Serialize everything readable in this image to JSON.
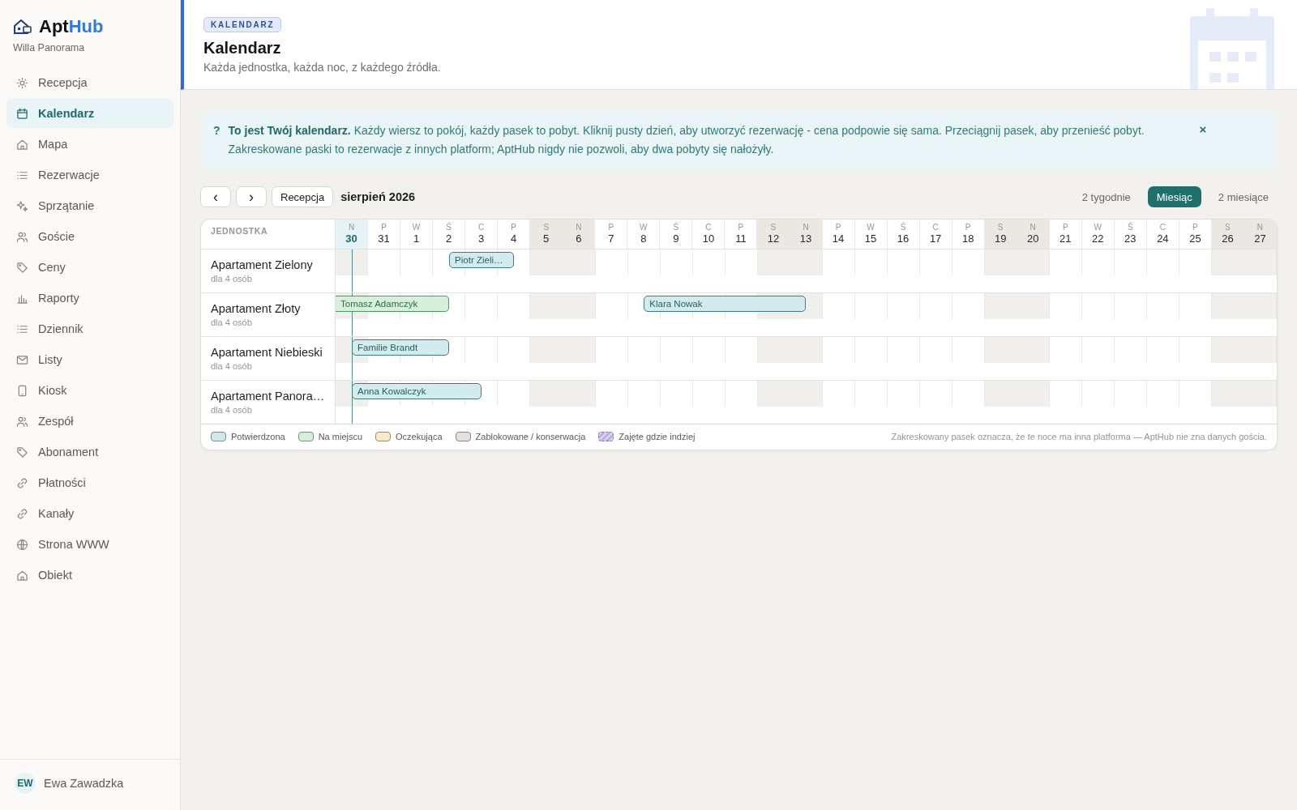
{
  "brand": {
    "name_start": "Apt",
    "name_end": "Hub",
    "property": "Willa Panorama"
  },
  "sidebar": {
    "items": [
      {
        "label": "Recepcja",
        "selected": false
      },
      {
        "label": "Kalendarz",
        "selected": true
      },
      {
        "label": "Mapa",
        "selected": false
      },
      {
        "label": "Rezerwacje",
        "selected": false
      },
      {
        "label": "Sprzątanie",
        "selected": false
      },
      {
        "label": "Goście",
        "selected": false
      },
      {
        "label": "Ceny",
        "selected": false
      },
      {
        "label": "Raporty",
        "selected": false
      },
      {
        "label": "Dziennik",
        "selected": false
      },
      {
        "label": "Listy",
        "selected": false
      },
      {
        "label": "Kiosk",
        "selected": false
      },
      {
        "label": "Zespół",
        "selected": false
      },
      {
        "label": "Abonament",
        "selected": false
      },
      {
        "label": "Płatności",
        "selected": false
      },
      {
        "label": "Kanały",
        "selected": false
      },
      {
        "label": "Strona WWW",
        "selected": false
      },
      {
        "label": "Obiekt",
        "selected": false
      }
    ],
    "user": {
      "initials": "EW",
      "name": "Ewa Zawadzka"
    }
  },
  "header": {
    "tag": "KALENDARZ",
    "title": "Kalendarz",
    "subtitle": "Każda jednostka, każda noc, z każdego źródła."
  },
  "notice": {
    "icon": "?",
    "text": "**To jest Twój kalendarz.** Każdy wiersz to pokój, każdy pasek to pobyt. Kliknij pusty dzień, aby utworzyć rezerwację - cena podpowie się sama. Przeciągnij pasek, aby przenieść pobyt. Zakreskowane paski to rezerwacje z innych platform; AptHub nigdy nie pozwoli, aby dwa pobyty się nałożyły.",
    "close": "×"
  },
  "toolbar": {
    "prev": "‹",
    "next": "›",
    "today": "Recepcja",
    "period": "sierpień 2026",
    "views": [
      {
        "label": "2 tygodnie",
        "selected": false
      },
      {
        "label": "Miesiąc",
        "selected": true
      },
      {
        "label": "2 miesiące",
        "selected": false
      }
    ]
  },
  "calendar": {
    "unit_header": "JEDNOSTKA",
    "days": [
      {
        "dow": "N",
        "day": "30",
        "kind": "today"
      },
      {
        "dow": "P",
        "day": "31",
        "kind": "weekday"
      },
      {
        "dow": "W",
        "day": "1",
        "kind": "weekday"
      },
      {
        "dow": "Ś",
        "day": "2",
        "kind": "weekday"
      },
      {
        "dow": "C",
        "day": "3",
        "kind": "weekday"
      },
      {
        "dow": "P",
        "day": "4",
        "kind": "weekday"
      },
      {
        "dow": "S",
        "day": "5",
        "kind": "weekend"
      },
      {
        "dow": "N",
        "day": "6",
        "kind": "weekend"
      },
      {
        "dow": "P",
        "day": "7",
        "kind": "weekday"
      },
      {
        "dow": "W",
        "day": "8",
        "kind": "weekday"
      },
      {
        "dow": "Ś",
        "day": "9",
        "kind": "weekday"
      },
      {
        "dow": "C",
        "day": "10",
        "kind": "weekday"
      },
      {
        "dow": "P",
        "day": "11",
        "kind": "weekday"
      },
      {
        "dow": "S",
        "day": "12",
        "kind": "weekend"
      },
      {
        "dow": "N",
        "day": "13",
        "kind": "weekend"
      },
      {
        "dow": "P",
        "day": "14",
        "kind": "weekday"
      },
      {
        "dow": "W",
        "day": "15",
        "kind": "weekday"
      },
      {
        "dow": "Ś",
        "day": "16",
        "kind": "weekday"
      },
      {
        "dow": "C",
        "day": "17",
        "kind": "weekday"
      },
      {
        "dow": "P",
        "day": "18",
        "kind": "weekday"
      },
      {
        "dow": "S",
        "day": "19",
        "kind": "weekend"
      },
      {
        "dow": "N",
        "day": "20",
        "kind": "weekend"
      },
      {
        "dow": "P",
        "day": "21",
        "kind": "weekday"
      },
      {
        "dow": "W",
        "day": "22",
        "kind": "weekday"
      },
      {
        "dow": "Ś",
        "day": "23",
        "kind": "weekday"
      },
      {
        "dow": "C",
        "day": "24",
        "kind": "weekday"
      },
      {
        "dow": "P",
        "day": "25",
        "kind": "weekday"
      },
      {
        "dow": "S",
        "day": "26",
        "kind": "weekend"
      },
      {
        "dow": "N",
        "day": "27",
        "kind": "weekend"
      }
    ],
    "units": [
      {
        "name": "Apartament Zielony",
        "capacity": "dla 4 osób",
        "bookings": [
          {
            "guest": "Piotr Zieli…",
            "kind": "confirmed"
          }
        ],
        "nights": [
          {
            "kind": "free"
          },
          {
            "kind": "free"
          },
          {
            "kind": "free"
          },
          {
            "kind": "arrival"
          },
          {
            "kind": "stay"
          },
          {
            "kind": "departure"
          },
          {
            "kind": "free"
          },
          {
            "kind": "free"
          },
          {
            "kind": "free"
          },
          {
            "kind": "free"
          },
          {
            "kind": "free"
          },
          {
            "kind": "free"
          },
          {
            "kind": "free"
          },
          {
            "kind": "free"
          },
          {
            "kind": "free"
          },
          {
            "kind": "free"
          },
          {
            "kind": "free"
          },
          {
            "kind": "free"
          },
          {
            "kind": "free"
          },
          {
            "kind": "free"
          },
          {
            "kind": "free"
          },
          {
            "kind": "free"
          },
          {
            "kind": "free"
          },
          {
            "kind": "free"
          },
          {
            "kind": "free"
          },
          {
            "kind": "free"
          },
          {
            "kind": "free"
          },
          {
            "kind": "free"
          },
          {
            "kind": "free"
          }
        ]
      },
      {
        "name": "Apartament Złoty",
        "capacity": "dla 4 osób",
        "bookings": [
          {
            "guest": "Tomasz Adamczyk",
            "kind": "onsite"
          },
          {
            "guest": "Klara Nowak",
            "kind": "confirmed"
          }
        ],
        "nights": [
          {
            "kind": "stay"
          },
          {
            "kind": "stay"
          },
          {
            "kind": "stay"
          },
          {
            "kind": "departure"
          },
          {
            "kind": "free"
          },
          {
            "kind": "free"
          },
          {
            "kind": "free"
          },
          {
            "kind": "free"
          },
          {
            "kind": "free"
          },
          {
            "kind": "arrival"
          },
          {
            "kind": "stay"
          },
          {
            "kind": "stay"
          },
          {
            "kind": "stay"
          },
          {
            "kind": "stay"
          },
          {
            "kind": "departure"
          },
          {
            "kind": "free"
          },
          {
            "kind": "free"
          },
          {
            "kind": "free"
          },
          {
            "kind": "free"
          },
          {
            "kind": "free"
          },
          {
            "kind": "free"
          },
          {
            "kind": "free"
          },
          {
            "kind": "free"
          },
          {
            "kind": "free"
          },
          {
            "kind": "free"
          },
          {
            "kind": "free"
          },
          {
            "kind": "free"
          },
          {
            "kind": "free"
          },
          {
            "kind": "free"
          }
        ]
      },
      {
        "name": "Apartament Niebieski",
        "capacity": "dla 4 osób",
        "bookings": [
          {
            "guest": "Familie Brandt",
            "kind": "confirmed"
          }
        ],
        "nights": [
          {
            "kind": "arrival"
          },
          {
            "kind": "stay"
          },
          {
            "kind": "stay"
          },
          {
            "kind": "departure"
          },
          {
            "kind": "free"
          },
          {
            "kind": "free"
          },
          {
            "kind": "free"
          },
          {
            "kind": "free"
          },
          {
            "kind": "free"
          },
          {
            "kind": "free"
          },
          {
            "kind": "free"
          },
          {
            "kind": "free"
          },
          {
            "kind": "free"
          },
          {
            "kind": "free"
          },
          {
            "kind": "free"
          },
          {
            "kind": "free"
          },
          {
            "kind": "free"
          },
          {
            "kind": "free"
          },
          {
            "kind": "free"
          },
          {
            "kind": "free"
          },
          {
            "kind": "free"
          },
          {
            "kind": "free"
          },
          {
            "kind": "free"
          },
          {
            "kind": "free"
          },
          {
            "kind": "free"
          },
          {
            "kind": "free"
          },
          {
            "kind": "free"
          },
          {
            "kind": "free"
          },
          {
            "kind": "free"
          }
        ]
      },
      {
        "name": "Apartament Panora…",
        "capacity": "dla 4 osób",
        "bookings": [
          {
            "guest": "Anna Kowalczyk",
            "kind": "confirmed"
          }
        ],
        "nights": [
          {
            "kind": "arrival"
          },
          {
            "kind": "stay"
          },
          {
            "kind": "stay"
          },
          {
            "kind": "stay"
          },
          {
            "kind": "departure"
          },
          {
            "kind": "free"
          },
          {
            "kind": "free"
          },
          {
            "kind": "free"
          },
          {
            "kind": "free"
          },
          {
            "kind": "free"
          },
          {
            "kind": "free"
          },
          {
            "kind": "free"
          },
          {
            "kind": "free"
          },
          {
            "kind": "free"
          },
          {
            "kind": "free"
          },
          {
            "kind": "free"
          },
          {
            "kind": "free"
          },
          {
            "kind": "free"
          },
          {
            "kind": "free"
          },
          {
            "kind": "free"
          },
          {
            "kind": "free"
          },
          {
            "kind": "free"
          },
          {
            "kind": "free"
          },
          {
            "kind": "free"
          },
          {
            "kind": "free"
          },
          {
            "kind": "free"
          },
          {
            "kind": "free"
          },
          {
            "kind": "free"
          },
          {
            "kind": "free"
          }
        ]
      }
    ],
    "legend": [
      {
        "label": "Potwierdzona",
        "kind": "solid",
        "color": "#cfe8ea"
      },
      {
        "label": "Na miejscu",
        "kind": "solid",
        "color": "#d5efdb"
      },
      {
        "label": "Oczekująca",
        "kind": "solid",
        "color": "#fbe8c6"
      },
      {
        "label": "Zablokowane / konserwacja",
        "kind": "solid",
        "color": "#e4e1dd"
      },
      {
        "label": "Zajęte gdzie indziej",
        "kind": "hatched",
        "color": "#d8d0ee"
      }
    ],
    "footnote": "Zakreskowany pasek oznacza, że te noce ma inna platforma — AptHub nie zna danych gościa."
  }
}
